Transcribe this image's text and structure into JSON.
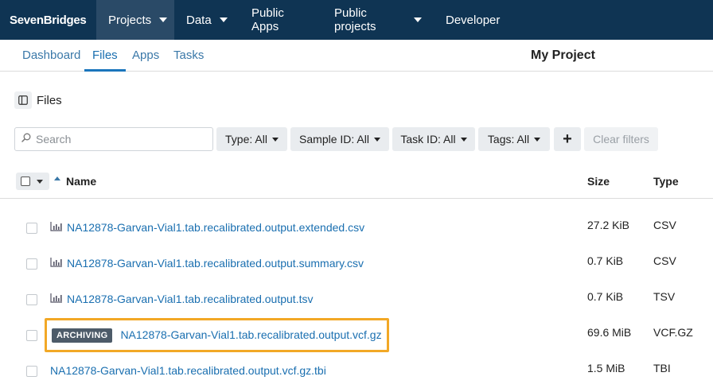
{
  "topnav": {
    "brand": "SevenBridges",
    "items": [
      {
        "label": "Projects",
        "has_caret": true,
        "active": true
      },
      {
        "label": "Data",
        "has_caret": true,
        "active": false
      },
      {
        "label": "Public Apps",
        "has_caret": false,
        "active": false
      },
      {
        "label": "Public projects",
        "has_caret": true,
        "active": false
      },
      {
        "label": "Developer",
        "has_caret": false,
        "active": false
      }
    ]
  },
  "subnav": {
    "tabs": [
      {
        "label": "Dashboard",
        "active": false
      },
      {
        "label": "Files",
        "active": true
      },
      {
        "label": "Apps",
        "active": false
      },
      {
        "label": "Tasks",
        "active": false
      }
    ],
    "project_title": "My Project"
  },
  "files_panel": {
    "title": "Files",
    "toggle_icon": "sidebar-panel-icon"
  },
  "filters": {
    "search_placeholder": "Search",
    "search_value": "",
    "type_label": "Type: All",
    "sample_label": "Sample ID: All",
    "task_label": "Task ID: All",
    "tags_label": "Tags: All",
    "add_label": "+",
    "clear_label": "Clear filters"
  },
  "table": {
    "columns": {
      "name": "Name",
      "size": "Size",
      "type": "Type"
    },
    "rows": [
      {
        "name": "NA12878-Garvan-Vial1.tab.recalibrated.output.extended.csv",
        "size": "27.2 KiB",
        "type": "CSV",
        "icon": "bar-chart-icon",
        "badge": ""
      },
      {
        "name": "NA12878-Garvan-Vial1.tab.recalibrated.output.summary.csv",
        "size": "0.7 KiB",
        "type": "CSV",
        "icon": "bar-chart-icon",
        "badge": ""
      },
      {
        "name": "NA12878-Garvan-Vial1.tab.recalibrated.output.tsv",
        "size": "0.7 KiB",
        "type": "TSV",
        "icon": "bar-chart-icon",
        "badge": ""
      },
      {
        "name": "NA12878-Garvan-Vial1.tab.recalibrated.output.vcf.gz",
        "size": "69.6 MiB",
        "type": "VCF.GZ",
        "icon": "",
        "badge": "ARCHIVING"
      },
      {
        "name": "NA12878-Garvan-Vial1.tab.recalibrated.output.vcf.gz.tbi",
        "size": "1.5 MiB",
        "type": "TBI",
        "icon": "",
        "badge": ""
      }
    ]
  },
  "colors": {
    "nav_bg": "#0f3453",
    "nav_active": "#2a4a67",
    "link": "#1a6fb0",
    "highlight": "#f2a826",
    "badge_bg": "#4d5b69"
  }
}
